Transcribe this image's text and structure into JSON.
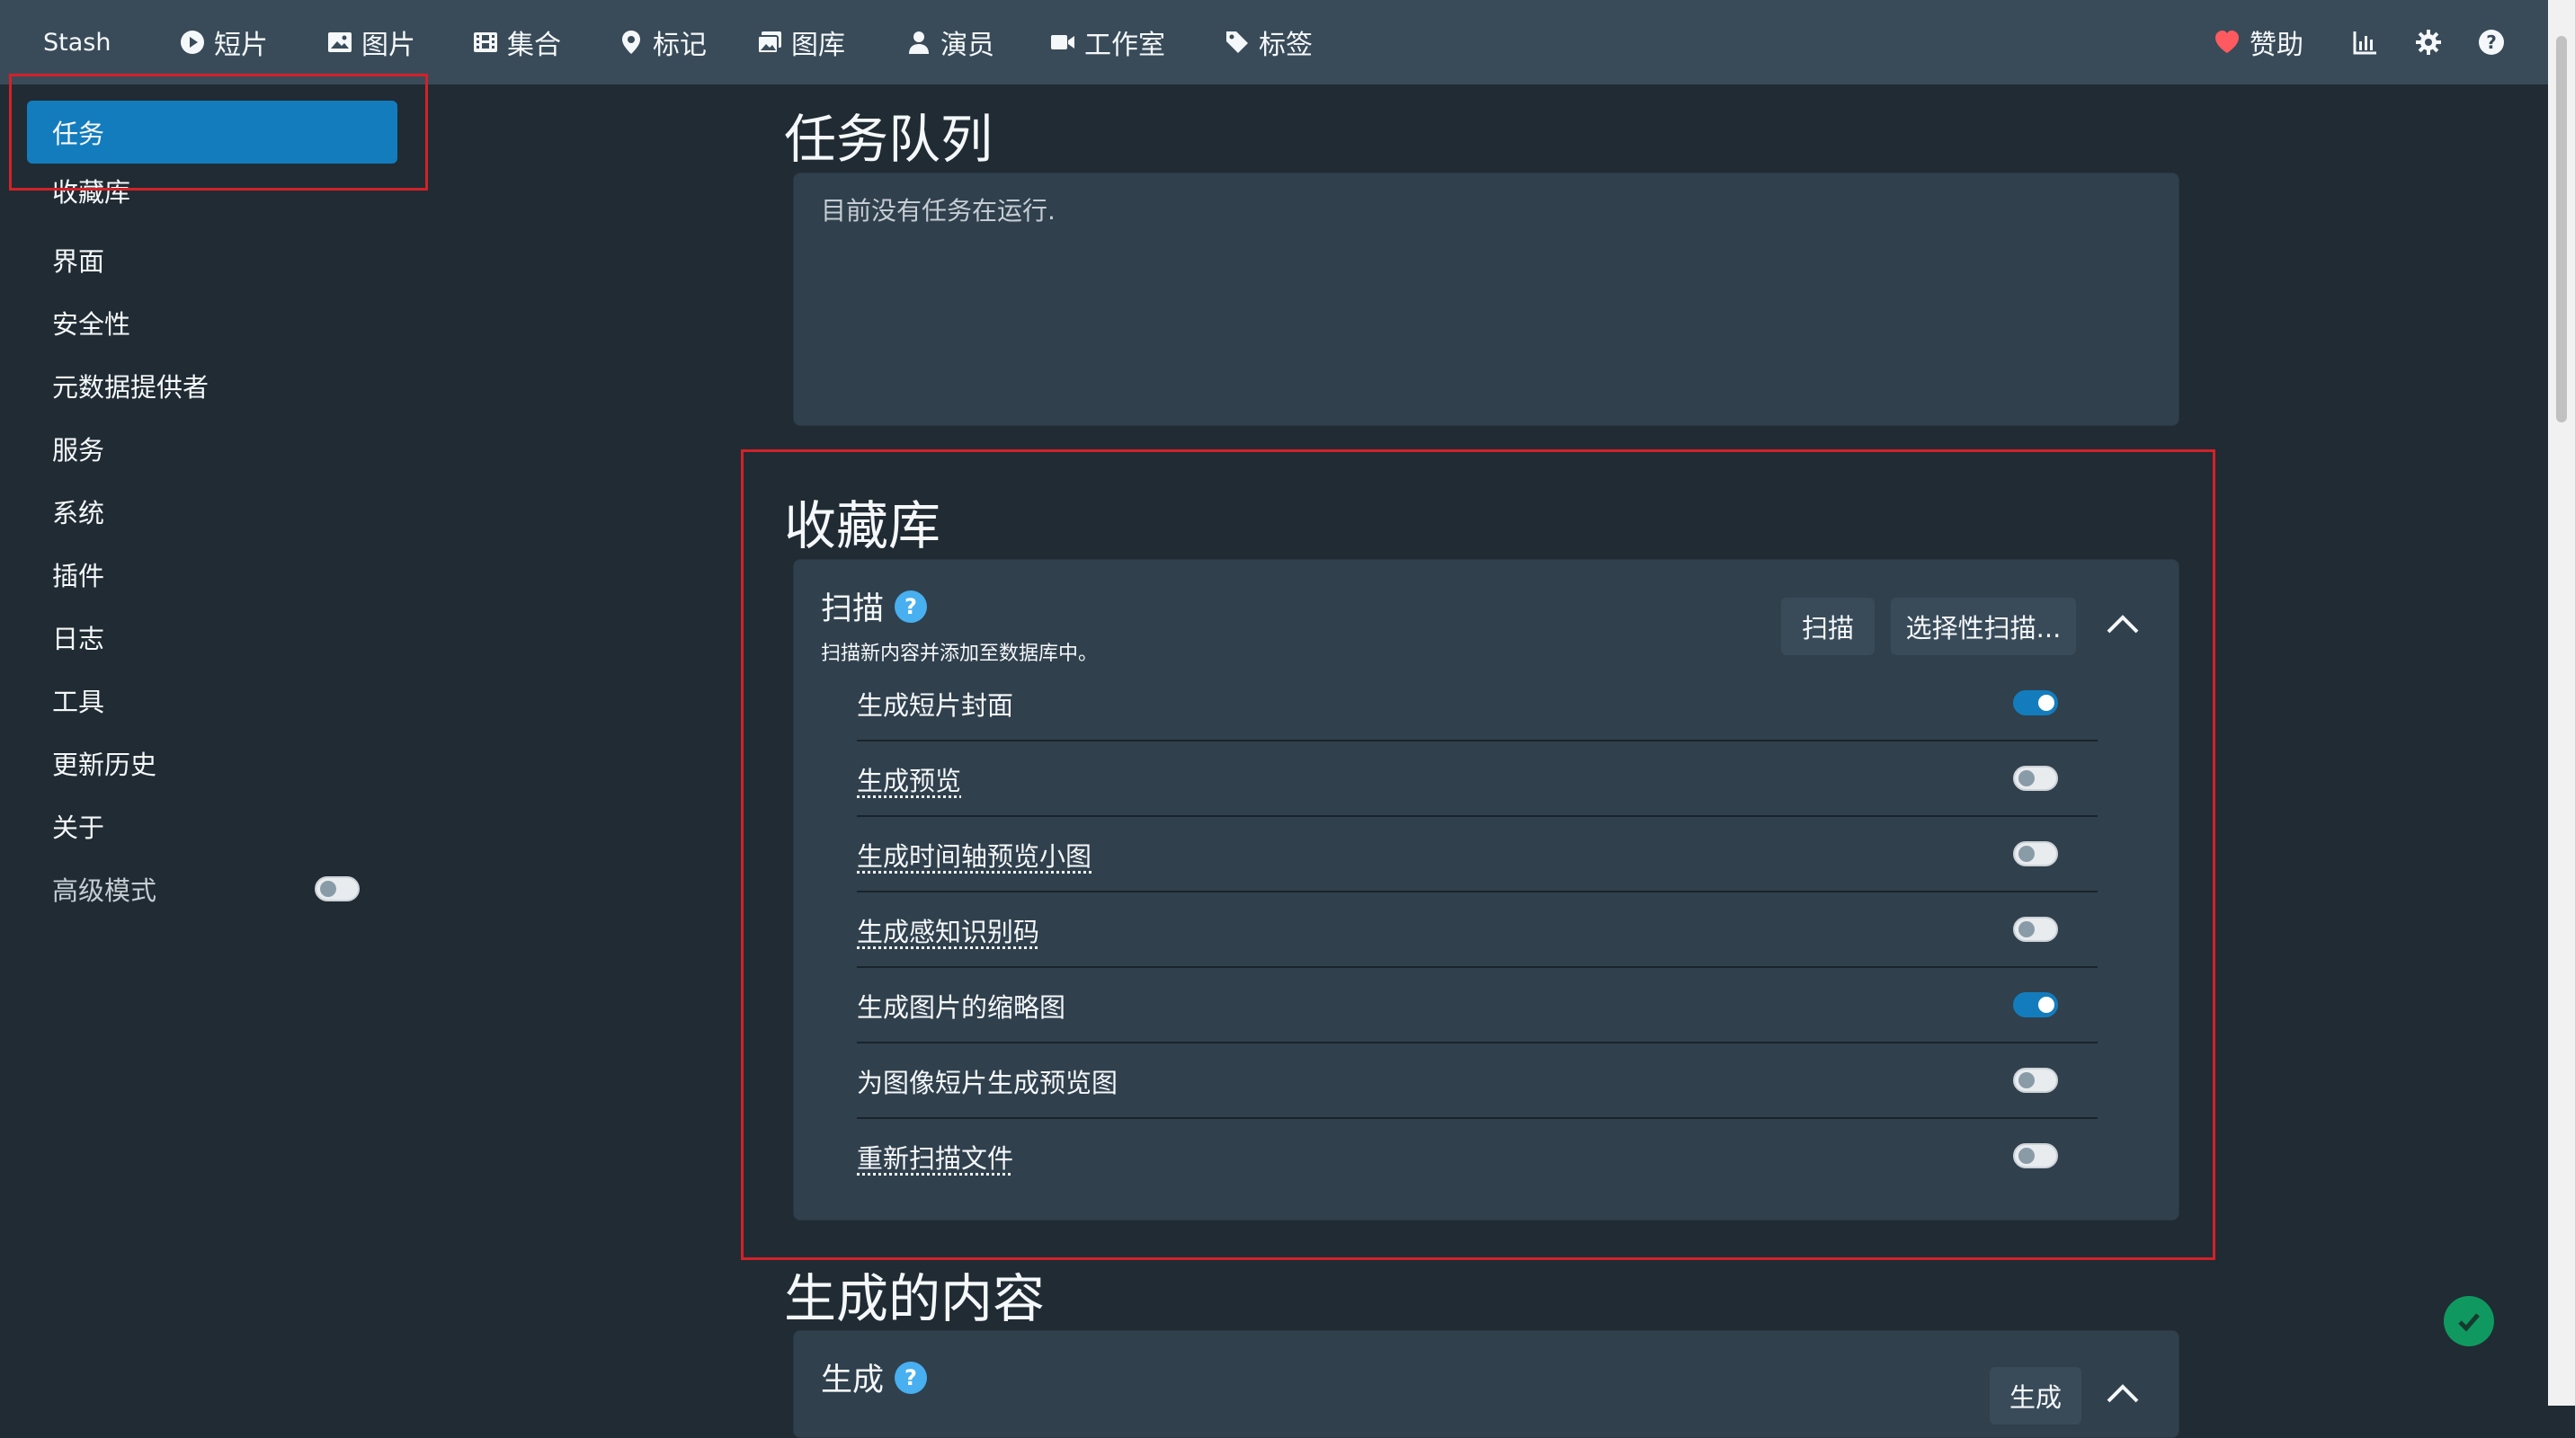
{
  "nav": {
    "brand": "Stash",
    "items": [
      {
        "label": "短片",
        "icon": "play-circle-icon"
      },
      {
        "label": "图片",
        "icon": "image-icon"
      },
      {
        "label": "集合",
        "icon": "film-icon"
      },
      {
        "label": "标记",
        "icon": "map-marker-icon"
      },
      {
        "label": "图库",
        "icon": "images-icon"
      },
      {
        "label": "演员",
        "icon": "user-icon"
      },
      {
        "label": "工作室",
        "icon": "video-icon"
      },
      {
        "label": "标签",
        "icon": "tag-icon"
      }
    ],
    "sponsor": {
      "label": "赞助",
      "icon": "heart-icon",
      "color": "#ff5a5f"
    },
    "right_icons": [
      "stats-chart-icon",
      "gear-icon",
      "help-icon"
    ]
  },
  "sidebar": {
    "items": [
      {
        "label": "任务",
        "active": true
      },
      {
        "label": "收藏库"
      },
      {
        "label": "界面"
      },
      {
        "label": "安全性"
      },
      {
        "label": "元数据提供者"
      },
      {
        "label": "服务"
      },
      {
        "label": "系统"
      },
      {
        "label": "插件"
      },
      {
        "label": "日志"
      },
      {
        "label": "工具"
      },
      {
        "label": "更新历史"
      },
      {
        "label": "关于"
      }
    ],
    "advanced_mode": {
      "label": "高级模式",
      "enabled": false
    }
  },
  "main": {
    "queue": {
      "title": "任务队列",
      "empty_text": "目前没有任务在运行."
    },
    "library": {
      "title": "收藏库",
      "scan": {
        "title": "扫描",
        "description": "扫描新内容并添加至数据库中。",
        "scan_button": "扫描",
        "selective_button": "选择性扫描...",
        "options": [
          {
            "label": "生成短片封面",
            "enabled": true,
            "underlined": false
          },
          {
            "label": "生成预览",
            "enabled": false,
            "underlined": true
          },
          {
            "label": "生成时间轴预览小图",
            "enabled": false,
            "underlined": true
          },
          {
            "label": "生成感知识别码",
            "enabled": false,
            "underlined": true
          },
          {
            "label": "生成图片的缩略图",
            "enabled": true,
            "underlined": false
          },
          {
            "label": "为图像短片生成预览图",
            "enabled": false,
            "underlined": false
          },
          {
            "label": "重新扫描文件",
            "enabled": false,
            "underlined": true
          }
        ]
      }
    },
    "generated": {
      "title": "生成的内容",
      "generate": {
        "title": "生成",
        "button": "生成"
      }
    }
  },
  "colors": {
    "navbar": "#394b59",
    "background": "#202b33",
    "card": "#30404d",
    "accent": "#137cbd",
    "help": "#48aff0",
    "highlight_box": "#d42128",
    "status_ok": "#0f9960"
  }
}
